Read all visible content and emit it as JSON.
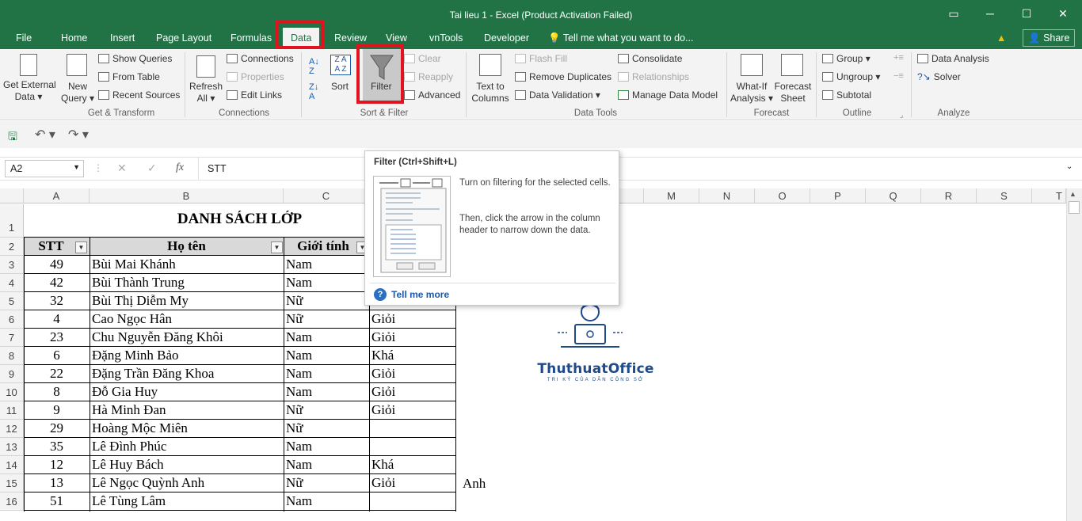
{
  "window": {
    "title": "Tai lieu 1 - Excel (Product Activation Failed)"
  },
  "tabs": [
    "File",
    "Home",
    "Insert",
    "Page Layout",
    "Formulas",
    "Data",
    "Review",
    "View",
    "vnTools",
    "Developer"
  ],
  "tell_me": "Tell me what you want to do...",
  "share": "Share",
  "ribbon": {
    "get_external": [
      "Get External",
      "Data"
    ],
    "new_query": [
      "New",
      "Query"
    ],
    "show_queries": "Show Queries",
    "from_table": "From Table",
    "recent_sources": "Recent Sources",
    "get_transform": "Get & Transform",
    "refresh": [
      "Refresh",
      "All"
    ],
    "connections": "Connections",
    "properties": "Properties",
    "edit_links": "Edit Links",
    "connections_group": "Connections",
    "sort": "Sort",
    "filter": "Filter",
    "clear": "Clear",
    "reapply": "Reapply",
    "advanced": "Advanced",
    "sort_filter_group": "Sort & Filter",
    "text_to_columns": [
      "Text to",
      "Columns"
    ],
    "flash_fill": "Flash Fill",
    "remove_duplicates": "Remove Duplicates",
    "data_validation": "Data Validation",
    "consolidate": "Consolidate",
    "relationships": "Relationships",
    "manage_data_model": "Manage Data Model",
    "data_tools_group": "Data Tools",
    "what_if": [
      "What-If",
      "Analysis"
    ],
    "forecast_sheet": [
      "Forecast",
      "Sheet"
    ],
    "forecast_group": "Forecast",
    "group": "Group",
    "ungroup": "Ungroup",
    "subtotal": "Subtotal",
    "outline_group": "Outline",
    "data_analysis": "Data Analysis",
    "solver": "Solver",
    "analyze_group": "Analyze"
  },
  "formula_bar": {
    "name_box": "A2",
    "fx": "fx",
    "value": "STT"
  },
  "columns": [
    "A",
    "B",
    "C",
    "M",
    "N",
    "O",
    "P",
    "Q",
    "R",
    "S",
    "T"
  ],
  "rows": [
    "1",
    "2",
    "3",
    "4",
    "5",
    "6",
    "7",
    "8",
    "9",
    "10",
    "11",
    "12",
    "13",
    "14",
    "15",
    "16"
  ],
  "sheet": {
    "title": "DANH SÁCH LỚP",
    "headers": [
      "STT",
      "Họ tên",
      "Giới tính"
    ],
    "records": [
      {
        "stt": "49",
        "name": "Bùi Mai Khánh",
        "gender": "Nam",
        "grade": ""
      },
      {
        "stt": "42",
        "name": "Bùi Thành Trung",
        "gender": "Nam",
        "grade": ""
      },
      {
        "stt": "32",
        "name": "Bùi Thị Diễm My",
        "gender": "Nữ",
        "grade": ""
      },
      {
        "stt": "4",
        "name": "Cao Ngọc Hân",
        "gender": "Nữ",
        "grade": "Giỏi"
      },
      {
        "stt": "23",
        "name": "Chu Nguyễn Đăng Khôi",
        "gender": "Nam",
        "grade": "Giỏi"
      },
      {
        "stt": "6",
        "name": "Đặng Minh Bảo",
        "gender": "Nam",
        "grade": "Khá"
      },
      {
        "stt": "22",
        "name": "Đặng Trần Đăng Khoa",
        "gender": "Nam",
        "grade": "Giỏi"
      },
      {
        "stt": "8",
        "name": "Đỗ Gia Huy",
        "gender": "Nam",
        "grade": "Giỏi"
      },
      {
        "stt": "9",
        "name": "Hà Minh Đan",
        "gender": "Nữ",
        "grade": "Giỏi"
      },
      {
        "stt": "29",
        "name": "Hoàng Mộc Miên",
        "gender": "Nữ",
        "grade": ""
      },
      {
        "stt": "35",
        "name": "Lê Đình Phúc",
        "gender": "Nam",
        "grade": ""
      },
      {
        "stt": "12",
        "name": "Lê Huy Bách",
        "gender": "Nam",
        "grade": "Khá"
      },
      {
        "stt": "13",
        "name": "Lê Ngọc Quỳnh Anh",
        "gender": "Nữ",
        "grade": "Giỏi"
      },
      {
        "stt": "51",
        "name": "Lê Tùng Lâm",
        "gender": "Nam",
        "grade": ""
      }
    ],
    "stray_text": "Anh"
  },
  "tooltip": {
    "title": "Filter (Ctrl+Shift+L)",
    "line1": "Turn on filtering for the selected cells.",
    "line2": "Then, click the arrow in the column header to narrow down the data.",
    "more": "Tell me more"
  },
  "logo": {
    "brand": "ThuthuatOffice",
    "tagline": "TRI KỶ CỦA DÂN CÔNG SỞ"
  },
  "colors": {
    "excel_green": "#217346",
    "highlight_red": "#e0141e"
  }
}
